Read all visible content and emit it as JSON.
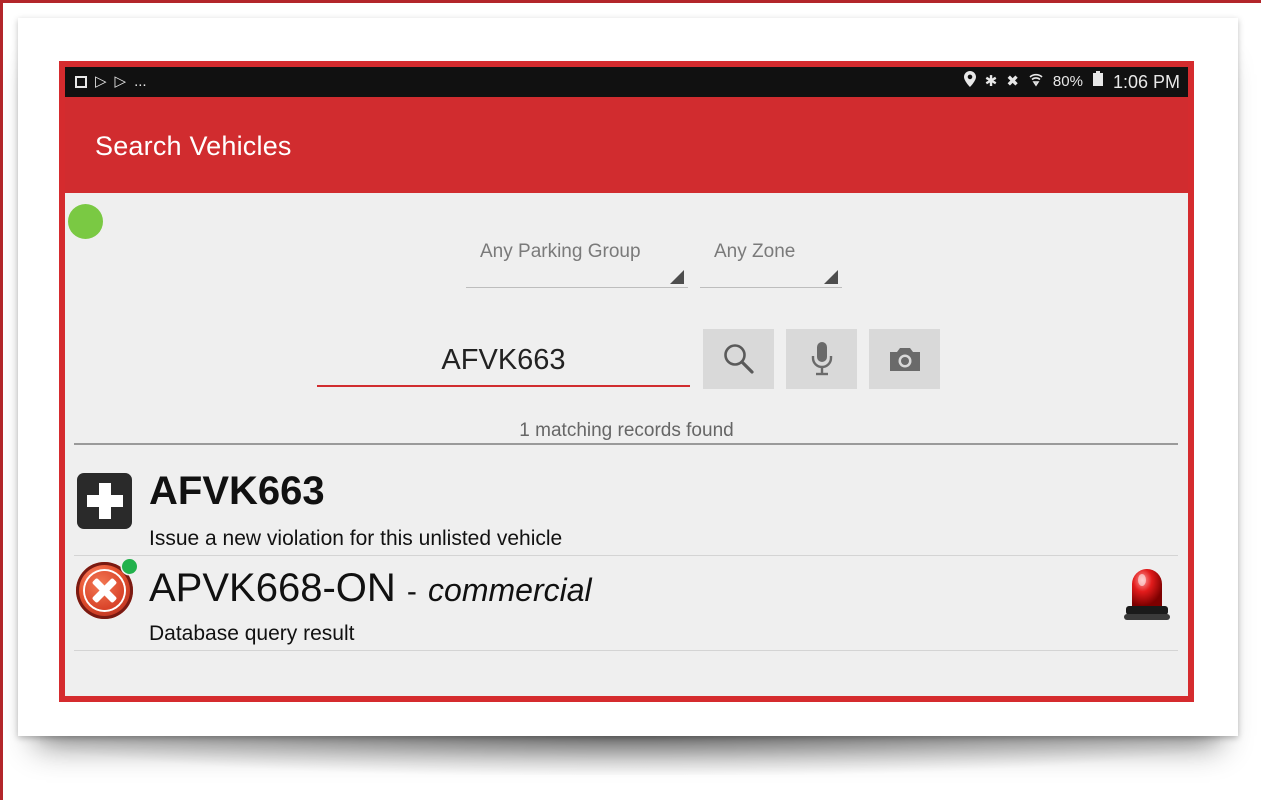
{
  "status_bar": {
    "left_overflow": "...",
    "battery": "80%",
    "time": "1:06 PM"
  },
  "app_bar": {
    "title": "Search Vehicles"
  },
  "filters": {
    "parking_group": "Any Parking Group",
    "zone": "Any Zone"
  },
  "search": {
    "value": "AFVK663",
    "buttons": [
      "search-icon",
      "microphone-icon",
      "camera-icon"
    ]
  },
  "results": {
    "summary": "1 matching records found",
    "items": [
      {
        "plate": "AFVK663",
        "subtitle": "Issue a new violation for this unlisted vehicle",
        "icon": "plus-icon"
      },
      {
        "plate": "APVK668-ON",
        "separator": "-",
        "category": "commercial",
        "subtitle": "Database query result",
        "icon": "error-x-icon",
        "alert_icon": "siren-icon"
      }
    ]
  },
  "colors": {
    "accent": "#d12c2f",
    "status_bar": "#111111",
    "background": "#efefef",
    "online": "#7ac943"
  }
}
